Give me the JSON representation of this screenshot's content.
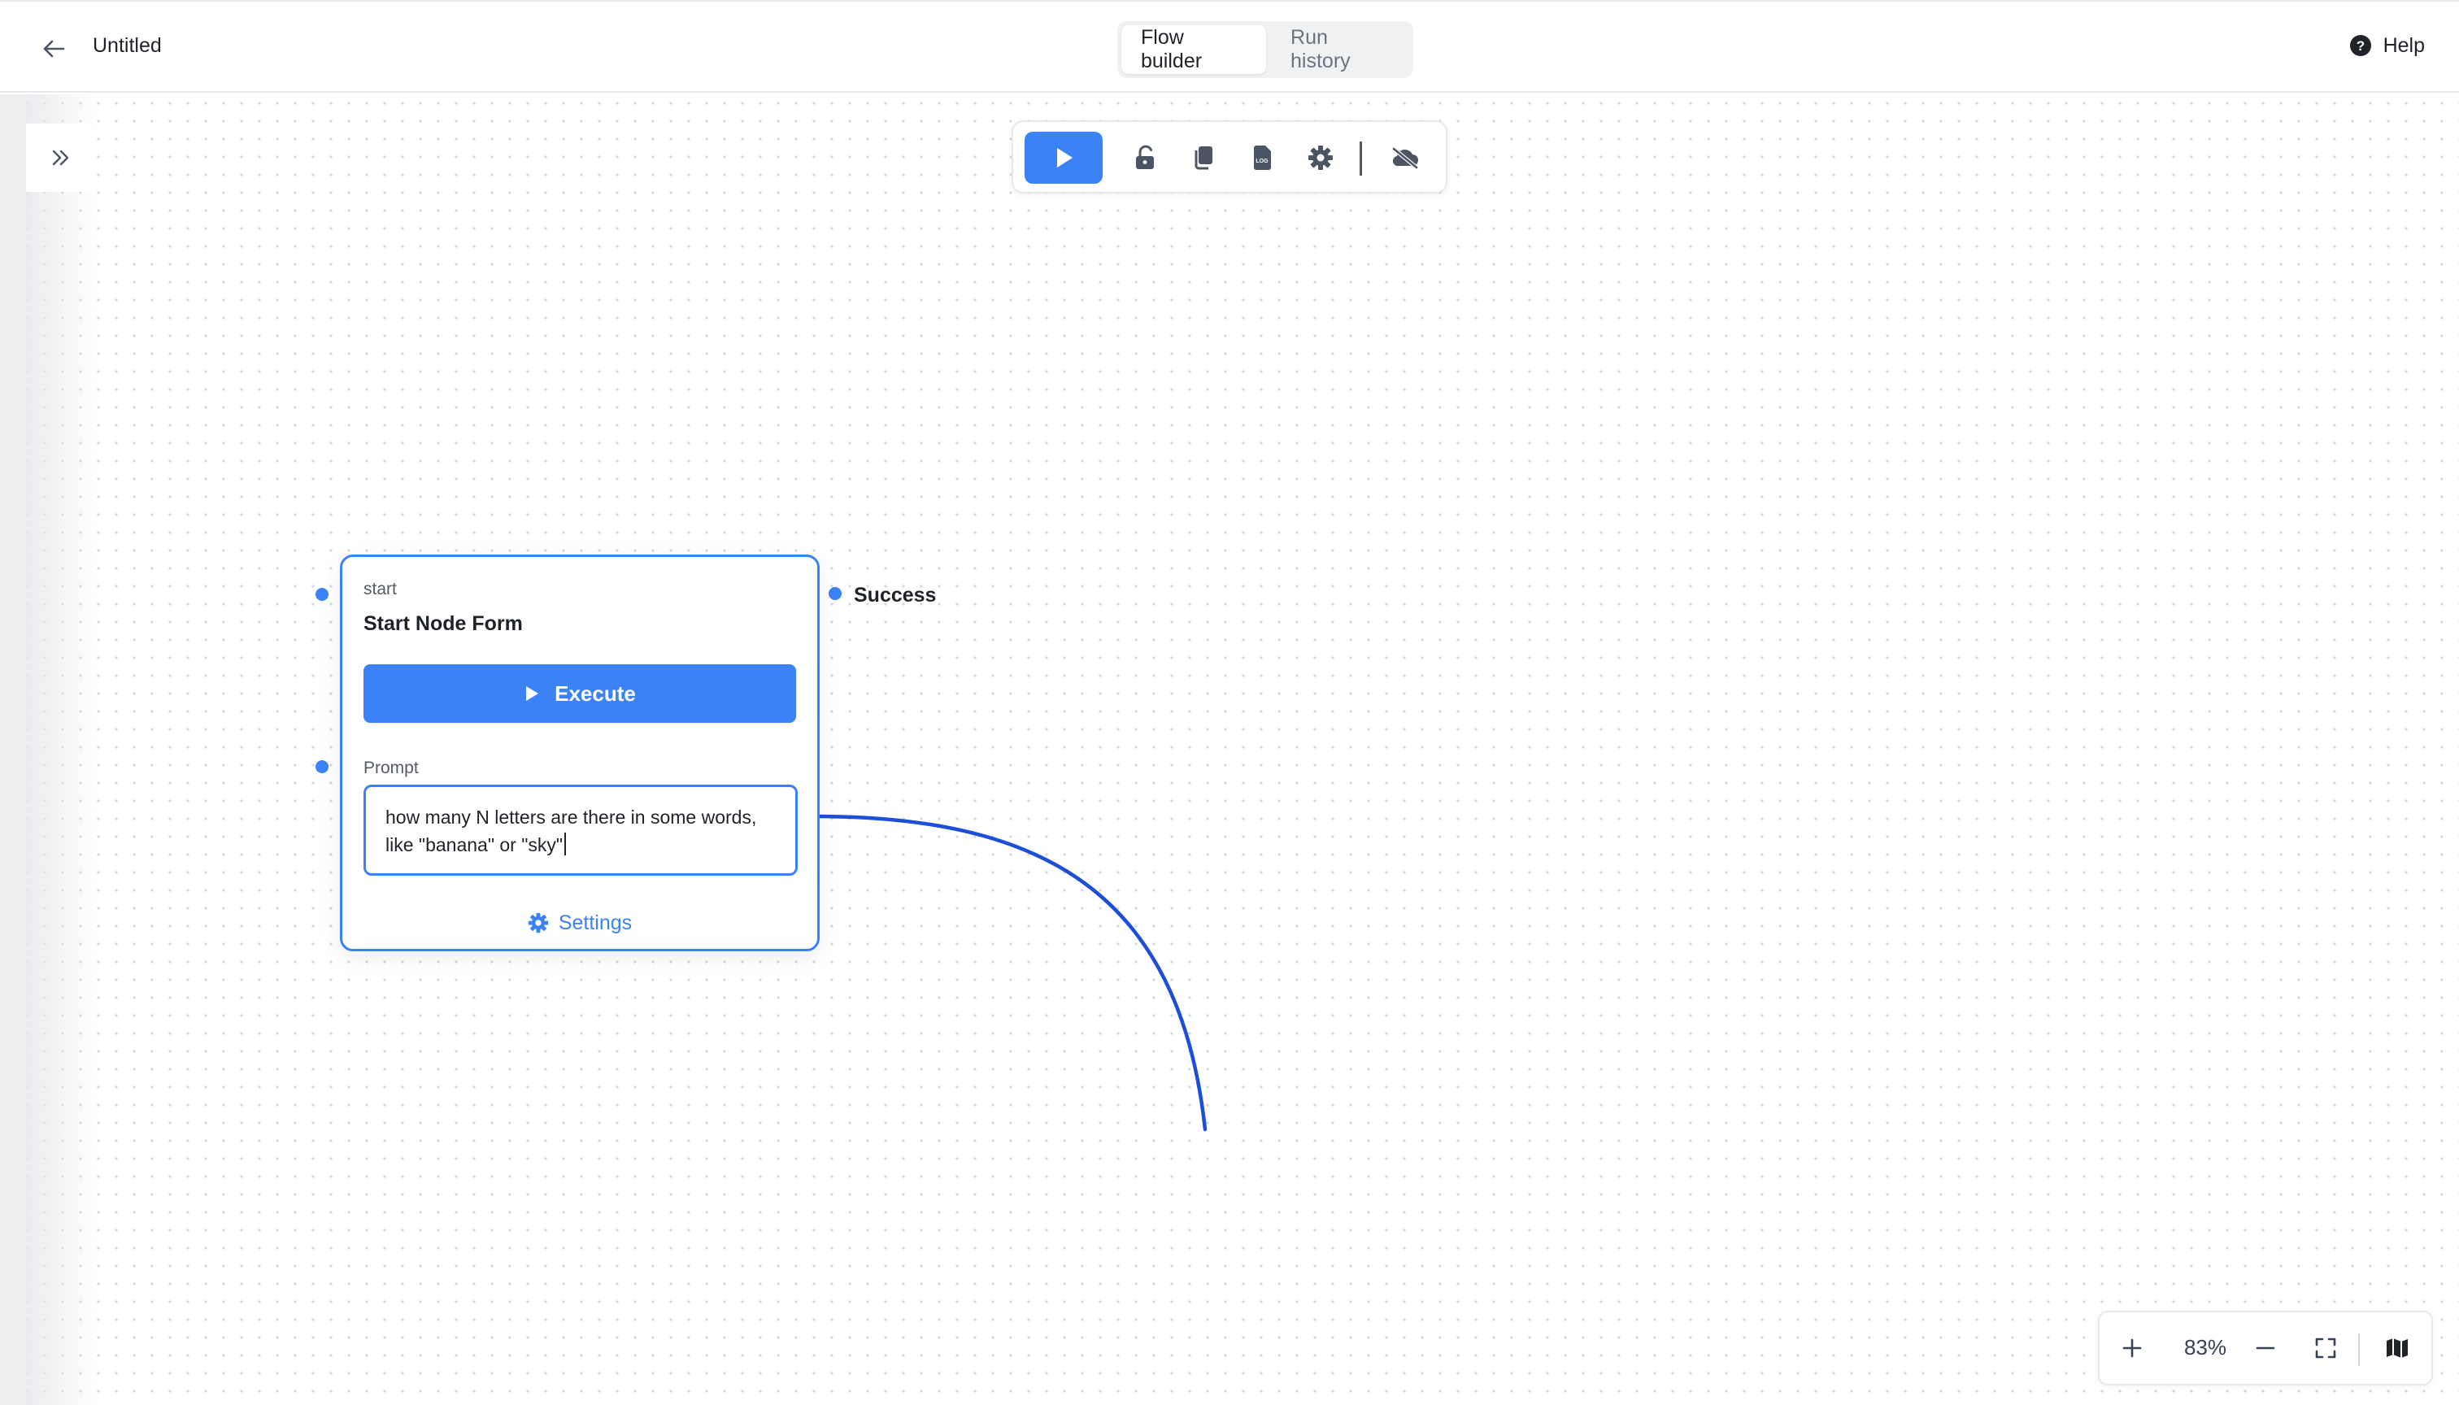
{
  "header": {
    "title": "Untitled",
    "tabs": [
      {
        "label": "Flow builder",
        "active": true
      },
      {
        "label": "Run history",
        "active": false
      }
    ],
    "help_label": "Help"
  },
  "toolbar": {
    "icons": [
      "play-icon",
      "unlock-icon",
      "copy-icon",
      "log-icon",
      "gear-icon",
      "cloud-off-icon"
    ]
  },
  "node": {
    "type": "start",
    "title": "Start Node Form",
    "execute_label": "Execute",
    "prompt_label": "Prompt",
    "prompt_value": "how many N letters are there in some words, like \"banana\" or \"sky\"",
    "settings_label": "Settings"
  },
  "output_handle_label": "Success",
  "zoom": {
    "level": "83%"
  },
  "colors": {
    "accent": "#3b82f6",
    "edge": "#1d4ed8",
    "canvas_dot": "#d3d6da"
  }
}
